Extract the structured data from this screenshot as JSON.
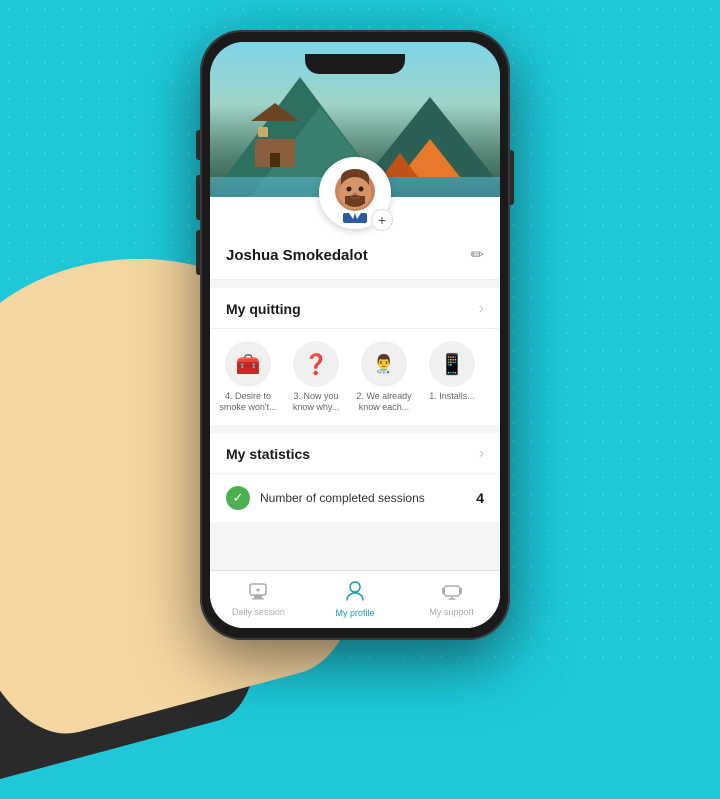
{
  "background": {
    "color": "#1ec8d8"
  },
  "phone": {
    "notch": true
  },
  "hero": {
    "alt": "Landscape with cabin and mountains"
  },
  "profile": {
    "username": "Joshua Smokedalot",
    "avatar_alt": "User avatar - man with beard"
  },
  "sections": {
    "quitting": {
      "title": "My quitting",
      "items": [
        {
          "icon": "🧰",
          "label": "4. Desire to smoke won't..."
        },
        {
          "icon": "❓",
          "label": "3. Now you know why..."
        },
        {
          "icon": "👨‍⚕️",
          "label": "2. We already know each..."
        },
        {
          "icon": "📱",
          "label": "1. Installs..."
        }
      ]
    },
    "statistics": {
      "title": "My statistics",
      "completed_sessions_label": "Number of completed sessions",
      "completed_sessions_value": "4"
    }
  },
  "bottom_nav": {
    "items": [
      {
        "label": "Daily session",
        "icon": "printer",
        "active": false
      },
      {
        "label": "My profile",
        "icon": "person",
        "active": true
      },
      {
        "label": "My support",
        "icon": "headset",
        "active": false
      }
    ]
  },
  "icons": {
    "edit": "✏",
    "chevron_right": "›",
    "plus": "+",
    "check": "✓",
    "daily_session": "🖨",
    "my_profile": "👤",
    "my_support": "🎧"
  }
}
